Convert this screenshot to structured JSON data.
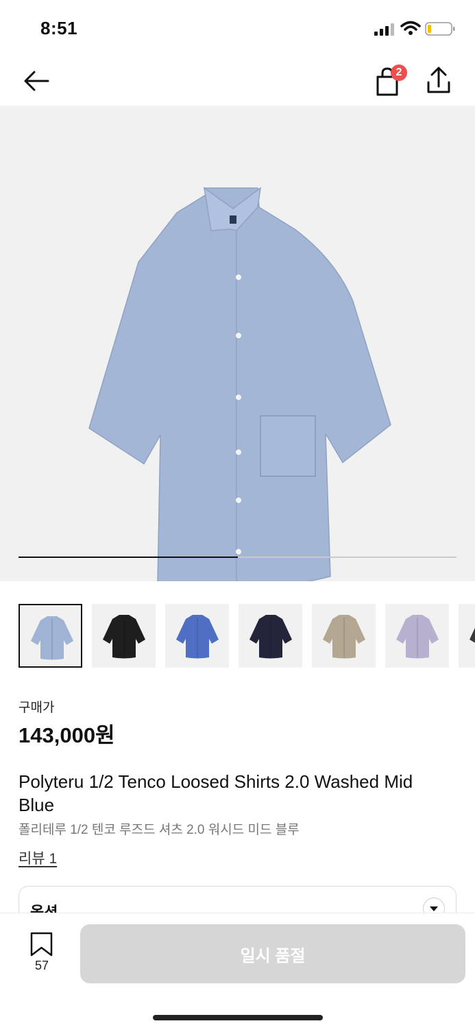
{
  "status_bar": {
    "time": "8:51"
  },
  "nav": {
    "cart_count": "2"
  },
  "gallery": {
    "progress_fraction": 0.5,
    "thumbnails": [
      {
        "color": "#9fb3d4",
        "selected": true
      },
      {
        "color": "#1e1e1e",
        "selected": false
      },
      {
        "color": "#4f6fc4",
        "selected": false
      },
      {
        "color": "#23263a",
        "selected": false
      },
      {
        "color": "#b3a791",
        "selected": false
      },
      {
        "color": "#b7b1cf",
        "selected": false
      },
      {
        "color": "#3a3a3a",
        "selected": false
      }
    ]
  },
  "product": {
    "price_label": "구매가",
    "price": "143,000원",
    "name_en": "Polyteru 1/2 Tenco Loosed Shirts 2.0 Washed Mid Blue",
    "name_ko": "폴리테루 1/2 텐코 루즈드 셔츠 2.0 워시드 미드 블루",
    "review_link": "리뷰 1"
  },
  "options": {
    "label": "옵션"
  },
  "bottom_bar": {
    "bookmark_count": "57",
    "soldout_label": "일시 품절"
  },
  "colors": {
    "badge": "#ef4e4e",
    "shirt": "#a3b6d6",
    "button_disabled": "#d6d6d6"
  }
}
